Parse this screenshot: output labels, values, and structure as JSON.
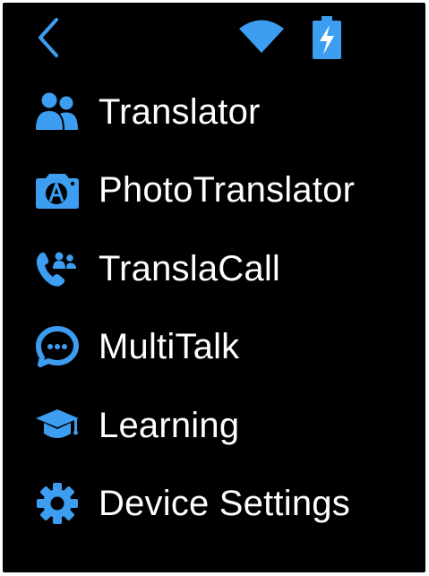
{
  "colors": {
    "accent": "#3d9df0",
    "background": "#000000",
    "text": "#ffffff"
  },
  "statusbar": {
    "back_icon": "chevron-left-icon",
    "wifi_icon": "wifi-icon",
    "battery_icon": "battery-charging-icon"
  },
  "menu": {
    "items": [
      {
        "label": "Translator",
        "icon": "people-icon"
      },
      {
        "label": "PhotoTranslator",
        "icon": "camera-translate-icon"
      },
      {
        "label": "TranslaCall",
        "icon": "phone-people-icon"
      },
      {
        "label": "MultiTalk",
        "icon": "chat-bubble-icon"
      },
      {
        "label": "Learning",
        "icon": "graduation-cap-icon"
      },
      {
        "label": "Device Settings",
        "icon": "gear-icon"
      }
    ]
  }
}
